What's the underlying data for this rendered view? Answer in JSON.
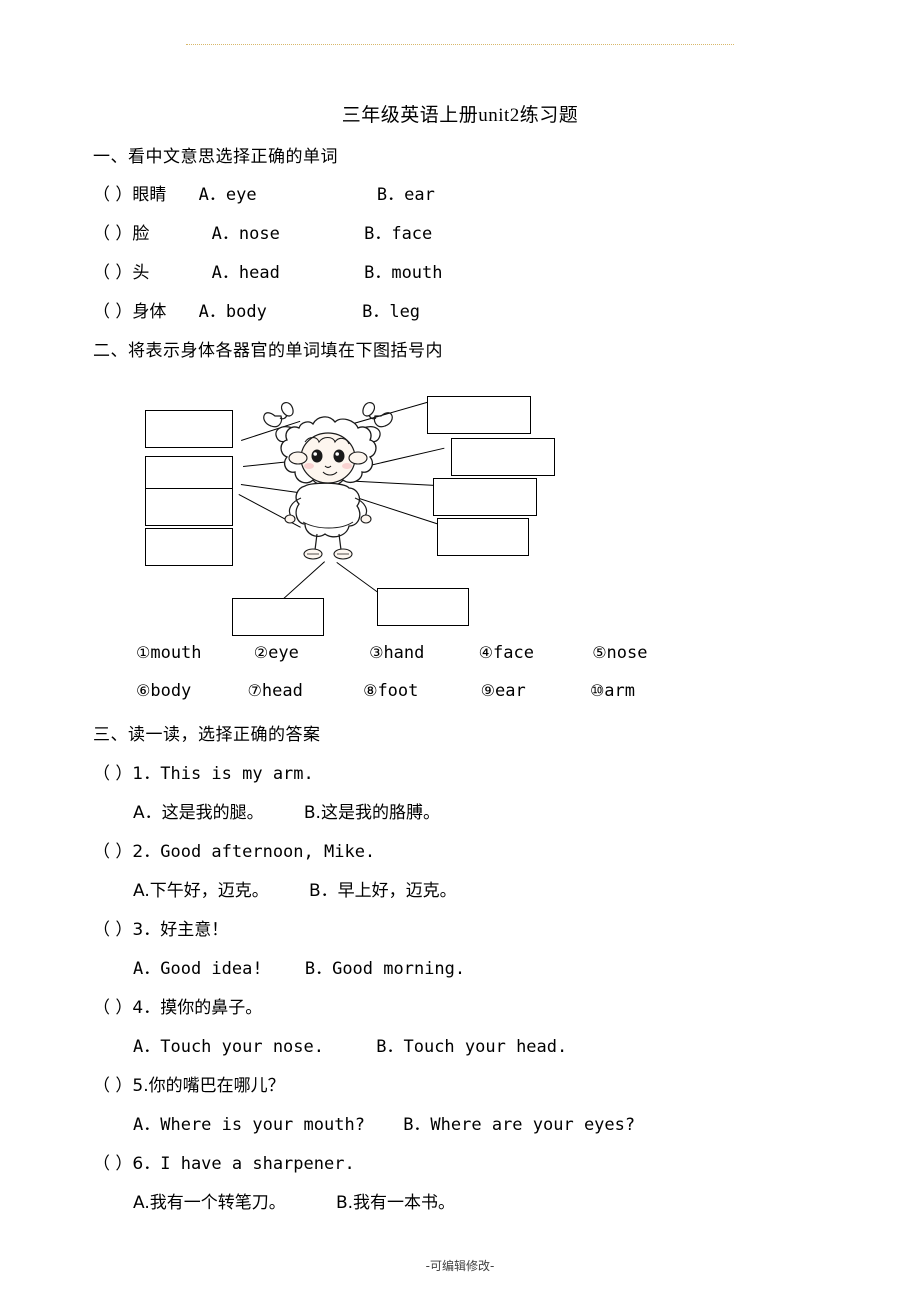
{
  "title": "三年级英语上册unit2练习题",
  "sections": [
    {
      "heading": "一、看中文意思选择正确的单词",
      "items": [
        {
          "bracket": "（    ）",
          "cn": "眼睛",
          "a": "A．eye",
          "b": "B．ear"
        },
        {
          "bracket": "（    ）",
          "cn": "脸",
          "a": "A．nose",
          "b": "B．face"
        },
        {
          "bracket": "（    ）",
          "cn": "头",
          "a": "A．head",
          "b": "B．mouth"
        },
        {
          "bracket": "（    ）",
          "cn": "身体",
          "a": "A．body",
          "b": "B．leg"
        }
      ]
    },
    {
      "heading": "二、将表示身体各器官的单词填在下图括号内",
      "word_bank": [
        {
          "num": "①",
          "word": "mouth"
        },
        {
          "num": "②",
          "word": "eye"
        },
        {
          "num": "③",
          "word": "hand"
        },
        {
          "num": "④",
          "word": "face"
        },
        {
          "num": "⑤",
          "word": "nose"
        },
        {
          "num": "⑥",
          "word": "body"
        },
        {
          "num": "⑦",
          "word": "head"
        },
        {
          "num": "⑧",
          "word": "foot"
        },
        {
          "num": "⑨",
          "word": "ear"
        },
        {
          "num": "⑩",
          "word": "arm"
        }
      ]
    },
    {
      "heading": "三、读一读，选择正确的答案",
      "items": [
        {
          "bracket": "（    ）",
          "number": "1．",
          "question": "This is my arm.",
          "a": "A．这是我的腿。",
          "b": "B.这是我的胳膊。"
        },
        {
          "bracket": "（    ）",
          "number": "2．",
          "question": "Good afternoon, Mike.",
          "a": "A.下午好，迈克。",
          "b": "B．早上好，迈克。"
        },
        {
          "bracket": "（    ）",
          "number": "3．",
          "question": "好主意！",
          "a": "A．Good idea!",
          "b": "B．Good morning."
        },
        {
          "bracket": "（    ）",
          "number": "4．",
          "question": "摸你的鼻子。",
          "a": "A．Touch your nose.",
          "b": "B．Touch your head."
        },
        {
          "bracket": "（    ）",
          "number": "5.",
          "question": "你的嘴巴在哪儿？",
          "a": "A．Where is your mouth?",
          "b": "B．Where are your eyes?"
        },
        {
          "bracket": "（    ）",
          "number": "6．",
          "question": "I have a sharpener.",
          "a": "A.我有一个转笔刀。",
          "b": "B.我有一本书。"
        }
      ]
    }
  ],
  "footer": "-可编辑修改-"
}
